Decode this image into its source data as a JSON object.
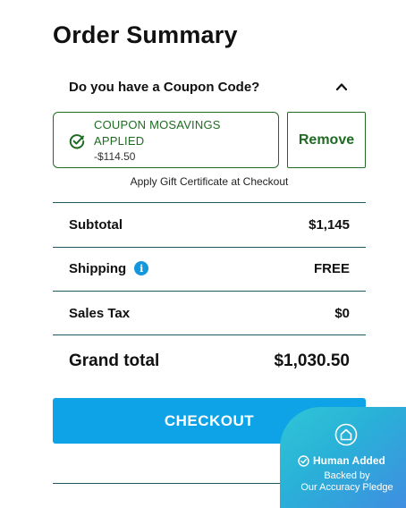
{
  "title": "Order Summary",
  "coupon": {
    "question": "Do you have a Coupon Code?",
    "applied_line1": "COUPON MOSAVINGS",
    "applied_line2": "APPLIED",
    "discount": "-$114.50",
    "remove_label": "Remove",
    "gift_note": "Apply Gift Certificate at Checkout"
  },
  "summary": {
    "subtotal_label": "Subtotal",
    "subtotal_value": "$1,145",
    "shipping_label": "Shipping",
    "shipping_value": "FREE",
    "tax_label": "Sales Tax",
    "tax_value": "$0",
    "grand_label": "Grand total",
    "grand_value": "$1,030.50"
  },
  "checkout_label": "CHECKOUT",
  "badge": {
    "title": "Human Added",
    "line1": "Backed by",
    "line2": "Our Accuracy Pledge"
  },
  "icons": {
    "chevron": "chevron-up-icon",
    "check": "check-circle-icon",
    "info": "info-icon",
    "house": "house-icon"
  },
  "colors": {
    "accent_green": "#1f6b23",
    "checkout_blue": "#0ea3e6",
    "divider": "#1c5a63",
    "info_blue": "#1597dd"
  }
}
